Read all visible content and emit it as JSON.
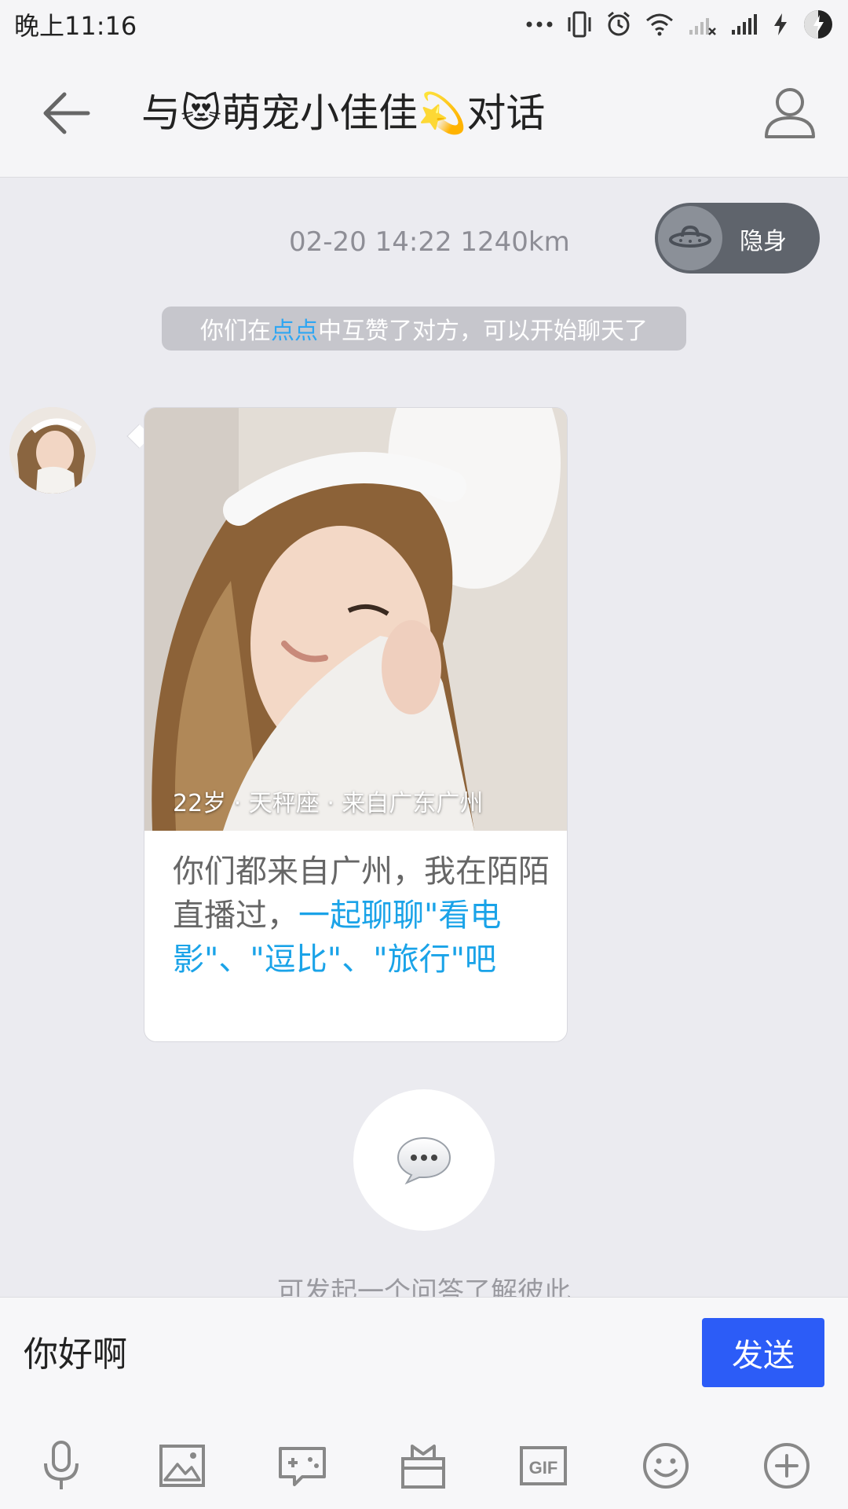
{
  "status_bar": {
    "time": "晚上11:16",
    "icons": [
      "dots-icon",
      "vibrate-icon",
      "alarm-icon",
      "wifi-icon",
      "signal-off-icon",
      "signal-icon",
      "charging-icon",
      "battery-icon"
    ]
  },
  "header": {
    "title": "与😻萌宠小佳佳💫对话",
    "back_icon": "back-arrow-icon",
    "profile_icon": "user-profile-icon"
  },
  "chat": {
    "timestamp": "02-20 14:22  1240km",
    "stealth_label": "隐身",
    "notice": {
      "prefix": "你们在",
      "highlight": "点点",
      "suffix": "中互赞了对方，可以开始聊天了"
    },
    "card": {
      "photo_info": "22岁 · 天秤座 · 来自广东广州",
      "text_plain": "你们都来自广州，我在陌陌直播过，",
      "text_link": "一起聊聊\"看电影\"、\"逗比\"、\"旅行\"吧"
    },
    "qa_icon": "speech-bubble-icon",
    "qa_text": "可发起一个问答了解彼此"
  },
  "input": {
    "value": "你好啊",
    "send_label": "发送"
  },
  "toolbar": [
    "microphone-icon",
    "image-icon",
    "game-icon",
    "gift-icon",
    "gif-icon",
    "emoji-icon",
    "plus-icon"
  ],
  "colors": {
    "accent": "#2c5cf7",
    "link": "#1aa3e8",
    "background": "#ebebf0"
  }
}
